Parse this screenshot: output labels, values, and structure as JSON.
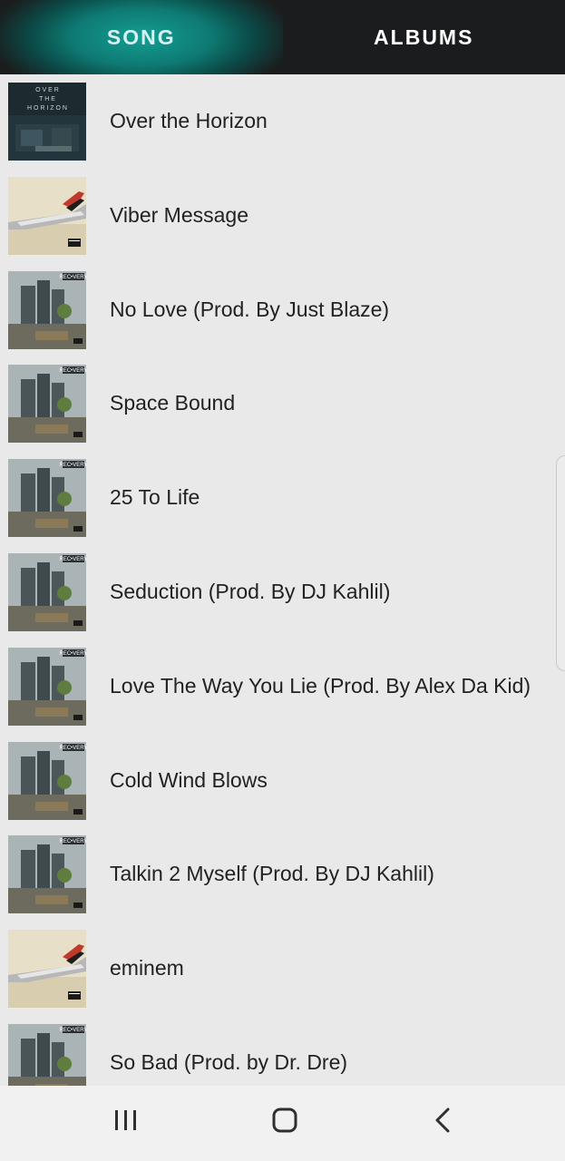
{
  "tabs": {
    "song": "SONG",
    "albums": "ALBUMS"
  },
  "songs": [
    {
      "title": "Over the Horizon",
      "cover": "over-the-horizon-cover"
    },
    {
      "title": "Viber Message",
      "cover": "kamikaze-cover"
    },
    {
      "title": "No Love (Prod. By Just Blaze)",
      "cover": "recovery-cover"
    },
    {
      "title": "Space Bound",
      "cover": "recovery-cover"
    },
    {
      "title": "25 To Life",
      "cover": "recovery-cover"
    },
    {
      "title": "Seduction (Prod. By DJ Kahlil)",
      "cover": "recovery-cover"
    },
    {
      "title": "Love The Way You Lie (Prod. By Alex Da Kid)",
      "cover": "recovery-cover"
    },
    {
      "title": "Cold Wind Blows",
      "cover": "recovery-cover"
    },
    {
      "title": "Talkin 2 Myself (Prod. By DJ Kahlil)",
      "cover": "recovery-cover"
    },
    {
      "title": "eminem",
      "cover": "kamikaze-cover"
    },
    {
      "title": "So Bad (Prod. by Dr. Dre)",
      "cover": "recovery-cover"
    }
  ],
  "covers": {
    "over_the_horizon_text": "O V E R\nT H E\nH O R I Z O N",
    "recovery_logo": "REC•VERY"
  },
  "nav": {
    "recents_icon": "recents-icon",
    "home_icon": "home-icon",
    "back_icon": "back-icon"
  }
}
